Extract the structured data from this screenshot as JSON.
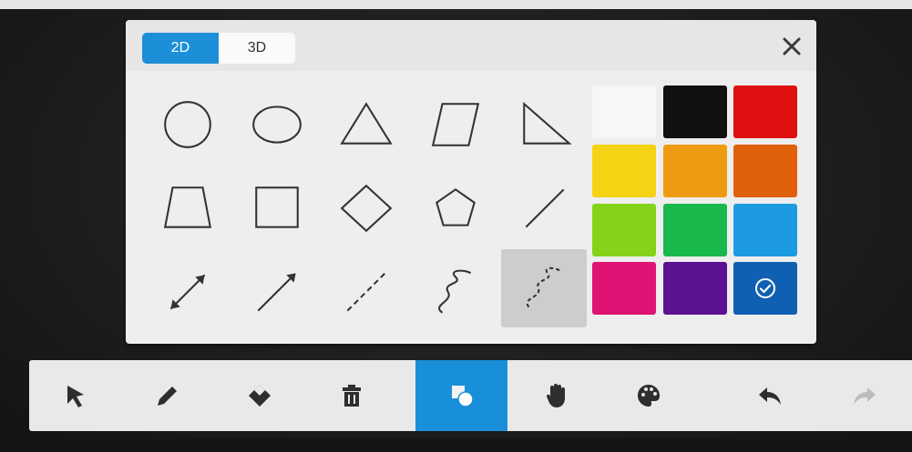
{
  "panel": {
    "tabs": [
      {
        "label": "2D",
        "active": true
      },
      {
        "label": "3D",
        "active": false
      }
    ],
    "close_icon": "close-icon",
    "shapes": [
      {
        "name": "circle",
        "selected": false
      },
      {
        "name": "ellipse",
        "selected": false
      },
      {
        "name": "triangle",
        "selected": false
      },
      {
        "name": "parallelogram",
        "selected": false
      },
      {
        "name": "right-triangle",
        "selected": false
      },
      {
        "name": "trapezoid",
        "selected": false
      },
      {
        "name": "square",
        "selected": false
      },
      {
        "name": "diamond",
        "selected": false
      },
      {
        "name": "pentagon",
        "selected": false
      },
      {
        "name": "line",
        "selected": false
      },
      {
        "name": "double-arrow",
        "selected": false
      },
      {
        "name": "arrow",
        "selected": false
      },
      {
        "name": "dashed-line",
        "selected": false
      },
      {
        "name": "curve",
        "selected": false
      },
      {
        "name": "dashed-curve",
        "selected": true
      }
    ],
    "colors": [
      {
        "hex": "#f7f7f7",
        "selected": false
      },
      {
        "hex": "#131010",
        "selected": false
      },
      {
        "hex": "#e01010",
        "selected": false
      },
      {
        "hex": "#f3d313",
        "selected": false
      },
      {
        "hex": "#ee9b12",
        "selected": false
      },
      {
        "hex": "#e1600c",
        "selected": false
      },
      {
        "hex": "#86d21a",
        "selected": false
      },
      {
        "hex": "#19b84c",
        "selected": false
      },
      {
        "hex": "#1d9be2",
        "selected": false
      },
      {
        "hex": "#de1373",
        "selected": false
      },
      {
        "hex": "#5a1192",
        "selected": false
      },
      {
        "hex": "#0f5fb2",
        "selected": true
      }
    ]
  },
  "toolbar": {
    "tools": [
      {
        "name": "select",
        "icon": "pointer-icon",
        "active": false,
        "disabled": false
      },
      {
        "name": "pen",
        "icon": "pencil-icon",
        "active": false,
        "disabled": false
      },
      {
        "name": "eraser",
        "icon": "eraser-icon",
        "active": false,
        "disabled": false
      },
      {
        "name": "delete",
        "icon": "trash-icon",
        "active": false,
        "disabled": false
      },
      {
        "name": "shapes",
        "icon": "shapes-icon",
        "active": true,
        "disabled": false
      },
      {
        "name": "pan",
        "icon": "hand-icon",
        "active": false,
        "disabled": false
      },
      {
        "name": "background",
        "icon": "palette-icon",
        "active": false,
        "disabled": false
      },
      {
        "name": "undo",
        "icon": "undo-icon",
        "active": false,
        "disabled": false
      },
      {
        "name": "redo",
        "icon": "redo-icon",
        "active": false,
        "disabled": true
      }
    ],
    "accent": "#1a8fd9"
  }
}
